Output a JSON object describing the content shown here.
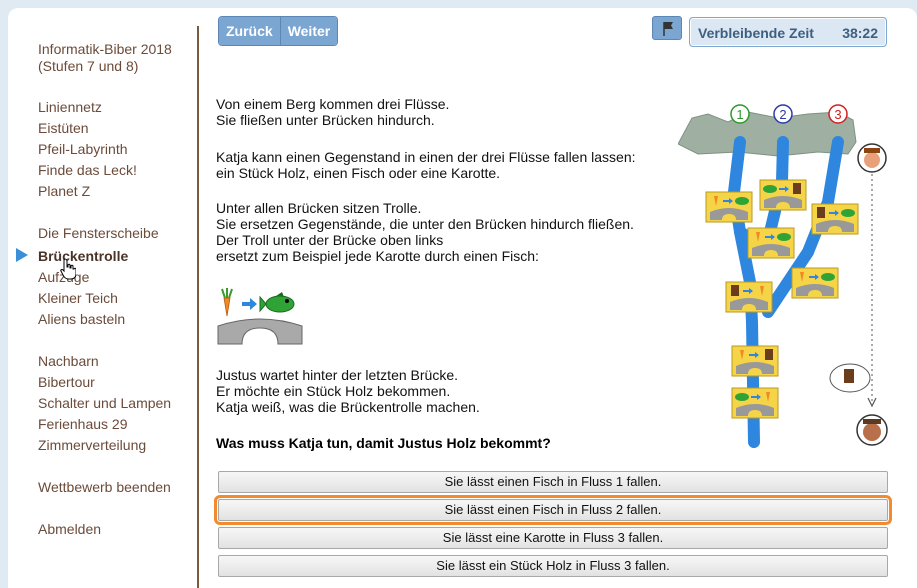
{
  "sidebar": {
    "title_line1": "Informatik-Biber 2018",
    "title_line2": "(Stufen 7 und 8)",
    "items": [
      "Liniennetz",
      "Eistüten",
      "Pfeil-Labyrinth",
      "Finde das Leck!",
      "Planet Z",
      "Die Fensterscheibe",
      "Brückentrolle",
      "Aufzüge",
      "Kleiner Teich",
      "Aliens basteln",
      "Nachbarn",
      "Bibertour",
      "Schalter und Lampen",
      "Ferienhaus 29",
      "Zimmerverteilung"
    ],
    "active_item": "Brückentrolle",
    "end_contest": "Wettbewerb beenden",
    "logout": "Abmelden"
  },
  "toolbar": {
    "back_label": "Zurück",
    "next_label": "Weiter"
  },
  "timer": {
    "label": "Verbleibende Zeit",
    "value": "38:22"
  },
  "task": {
    "para1_line1": "Von einem Berg kommen drei Flüsse.",
    "para1_line2": "Sie fließen unter Brücken hindurch.",
    "para2_line1": "Katja kann einen Gegenstand in einen der drei Flüsse fallen lassen:",
    "para2_line2": "ein Stück Holz, einen Fisch oder eine Karotte.",
    "para3_line1": "Unter allen Brücken sitzen Trolle.",
    "para3_line2": "Sie ersetzen Gegenstände, die unter den Brücken hindurch fließen.",
    "para3_line3": "Der Troll unter der Brücke oben links",
    "para3_line4": "ersetzt zum Beispiel jede Karotte durch einen Fisch:",
    "para4_line1": "Justus wartet hinter der letzten Brücke.",
    "para4_line2": "Er möchte ein Stück Holz bekommen.",
    "para4_line3": "Katja weiß, was die Brückentrolle machen.",
    "question": "Was muss Katja tun, damit Justus Holz bekommt?"
  },
  "rivers": {
    "labels": [
      "1",
      "2",
      "3"
    ]
  },
  "answers": [
    "Sie lässt einen Fisch in Fluss 1 fallen.",
    "Sie lässt einen Fisch in Fluss 2 fallen.",
    "Sie lässt eine Karotte in Fluss 3 fallen.",
    "Sie lässt ein Stück Holz in Fluss 3 fallen."
  ],
  "selected_answer_index": 1,
  "colors": {
    "accent_blue": "#7ba6d2",
    "selection_orange": "#f28a2e",
    "sidebar_text": "#6b4b3a",
    "river_blue": "#2e86de"
  }
}
